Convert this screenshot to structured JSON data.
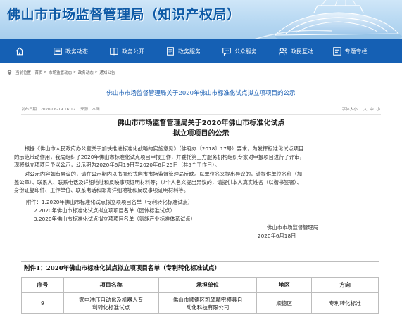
{
  "site": {
    "title": "佛山市市场监督管理局（知识产权局）"
  },
  "nav": {
    "items": [
      {
        "label": "",
        "icon": "home-icon"
      },
      {
        "label": "政务动态",
        "icon": "news-icon"
      },
      {
        "label": "政务公开",
        "icon": "book-icon"
      },
      {
        "label": "政务服务",
        "icon": "doc-icon"
      },
      {
        "label": "公众服务",
        "icon": "chat-icon"
      },
      {
        "label": "政民互动",
        "icon": "people-icon"
      },
      {
        "label": "专题专栏",
        "icon": "topic-icon"
      }
    ]
  },
  "breadcrumb": {
    "prefix": "当前位置：",
    "items": [
      "首页",
      "市场监管动态",
      "政务动态",
      "通知公告"
    ],
    "separator": ">"
  },
  "article": {
    "page_title": "佛山市市场监督管理局关于2020年佛山市标准化试点拟立项项目的公示",
    "publish_time": "发布日期：2020-06-19 16:12",
    "source": "来源：本网",
    "font_size_label": "字体大小：",
    "font_sizes": [
      "大",
      "中",
      "小"
    ],
    "heading_line1": "佛山市市场监督管理局关于2020年佛山市标准化试点",
    "heading_line2": "拟立项项目的公示",
    "p1_line1": "根据《佛山市人民政府办公室关于加快推进标准化战略的实施意见》（佛府办〔2018〕17号）要求，为发挥标准化试点项目",
    "p1_line2": "的示范带动作用，我局组织了2020年佛山市标准化试点项目申报工作，并委托第三方服务机构组织专家对申报项目进行了评审，",
    "p1_line3": "现将拟立项项目予以公示，公示期为2020年6月19日至2020年6月25日（共5个工作日）。",
    "p2_line1": "对公示内容如有异议的，请在公示期内以书面形式向市市场监督管理局反映。以单位名义提出异议的，请提供单位名称（加",
    "p2_line2": "盖公章）、联系人、联系电话及详细地址和反映事项证明材料等；以个人名义提出异议的，请提供本人真实姓名（以楷书签署）、",
    "p2_line3": "身份证复印件、工作单位、联系电话和邮寄详细地址和反映事项证明材料等。",
    "attachments_label": "附件：",
    "attachments": [
      "1.2020年佛山市标准化试点拟立项项目名单（专利转化标准试点）",
      "2.2020年佛山市标准化试点拟立项项目名单（团体标准试点）",
      "3.2020年佛山市标准化试点拟立项项目名单（氢能产业标准体系试点）"
    ],
    "signer": "佛山市市场监督管理局",
    "sign_date": "2020年6月18日"
  },
  "attachment_table": {
    "caption": "附件1：2020年佛山市标准化试点拟立项项目名单（专利转化标准试点）",
    "headers": [
      "序号",
      "项目名称",
      "承担单位",
      "地区",
      "方向"
    ],
    "rows": [
      {
        "no": "9",
        "name_line1": "家电冲压自动化及机器人专",
        "name_line2": "利转化标准试点",
        "unit_line1": "佛山市顺德区凯硕精密模具自",
        "unit_line2": "动化科技有限公司",
        "region": "顺德区",
        "direction": "专利转化标准"
      }
    ]
  },
  "colors": {
    "nav_bg": "#1560b4",
    "title_blue": "#0e5aa6",
    "link_blue": "#1a5fb4"
  }
}
